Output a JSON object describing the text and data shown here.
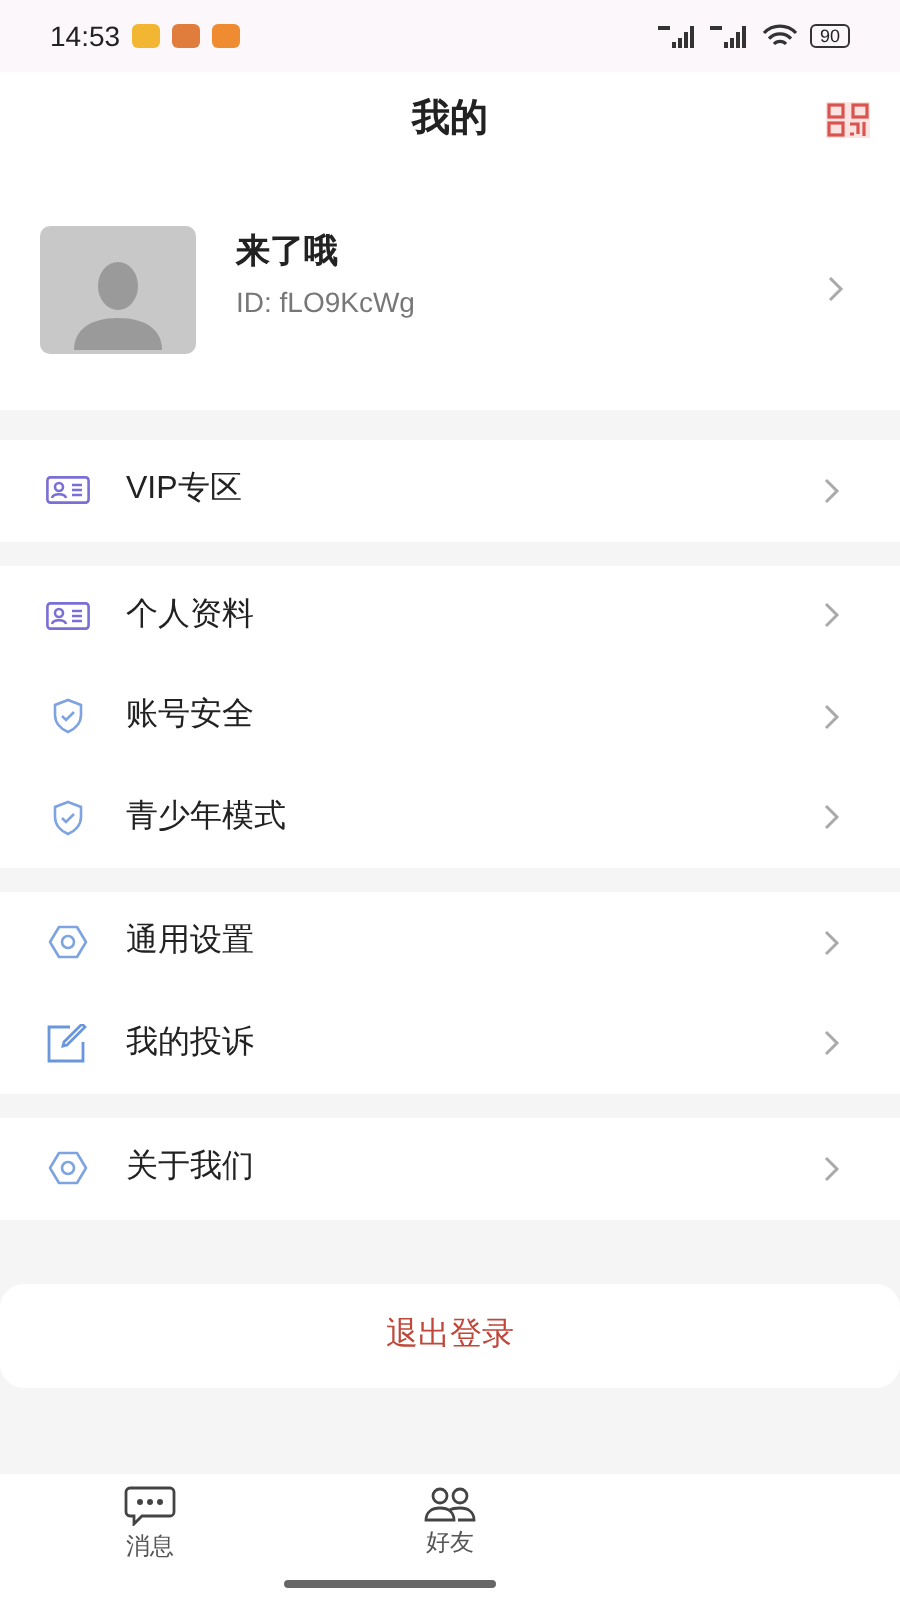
{
  "status_bar": {
    "time": "14:53",
    "battery": "90"
  },
  "header": {
    "title": "我的"
  },
  "profile": {
    "name": "来了哦",
    "id": "ID: fLO9KcWg"
  },
  "sections": [
    [
      {
        "label": "VIP专区"
      }
    ],
    [
      {
        "label": "个人资料"
      },
      {
        "label": "账号安全"
      },
      {
        "label": "青少年模式"
      }
    ],
    [
      {
        "label": "通用设置"
      },
      {
        "label": "我的投诉"
      }
    ],
    [
      {
        "label": "关于我们"
      }
    ]
  ],
  "logout": "退出登录",
  "tabs": [
    {
      "label": "消息",
      "selected": false
    },
    {
      "label": "好友",
      "selected": false
    }
  ]
}
